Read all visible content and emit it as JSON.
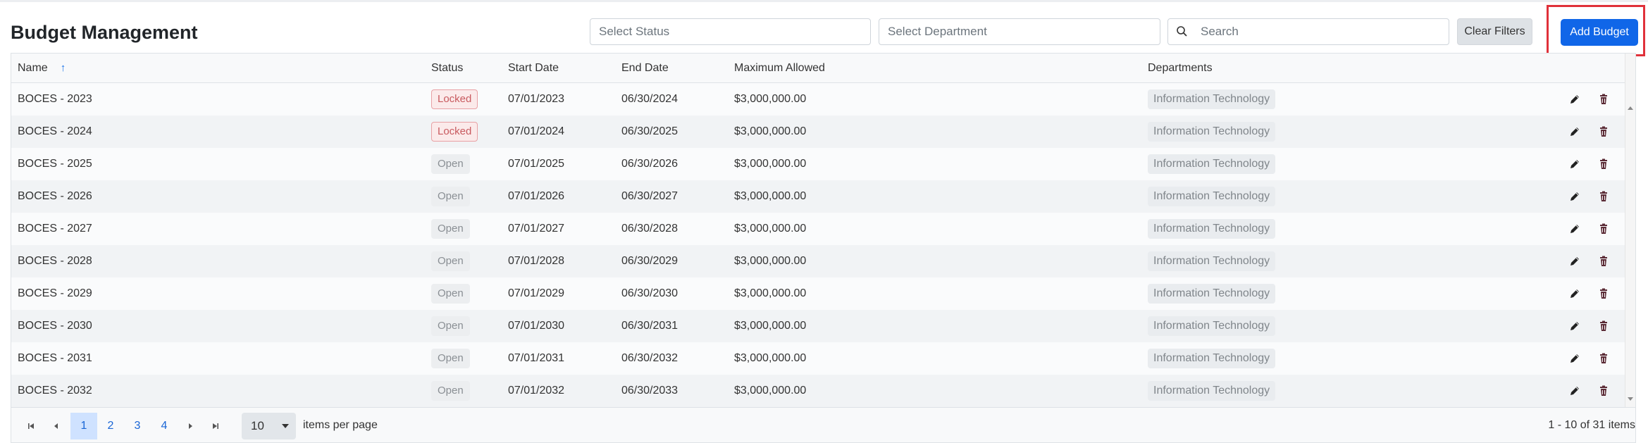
{
  "header": {
    "title": "Budget Management",
    "status_placeholder": "Select Status",
    "department_placeholder": "Select Department",
    "search_placeholder": "Search",
    "clear_filters_label": "Clear Filters",
    "add_budget_label": "Add Budget",
    "highlight_color": "#e0313a"
  },
  "table": {
    "columns": {
      "name": "Name",
      "status": "Status",
      "start_date": "Start Date",
      "end_date": "End Date",
      "maximum_allowed": "Maximum Allowed",
      "departments": "Departments"
    },
    "sort": {
      "column": "Name",
      "direction": "ascending"
    },
    "rows": [
      {
        "name": "BOCES - 2023",
        "status": "Locked",
        "start": "07/01/2023",
        "end": "06/30/2024",
        "max": "$3,000,000.00",
        "dept": "Information Technology"
      },
      {
        "name": "BOCES - 2024",
        "status": "Locked",
        "start": "07/01/2024",
        "end": "06/30/2025",
        "max": "$3,000,000.00",
        "dept": "Information Technology"
      },
      {
        "name": "BOCES - 2025",
        "status": "Open",
        "start": "07/01/2025",
        "end": "06/30/2026",
        "max": "$3,000,000.00",
        "dept": "Information Technology"
      },
      {
        "name": "BOCES - 2026",
        "status": "Open",
        "start": "07/01/2026",
        "end": "06/30/2027",
        "max": "$3,000,000.00",
        "dept": "Information Technology"
      },
      {
        "name": "BOCES - 2027",
        "status": "Open",
        "start": "07/01/2027",
        "end": "06/30/2028",
        "max": "$3,000,000.00",
        "dept": "Information Technology"
      },
      {
        "name": "BOCES - 2028",
        "status": "Open",
        "start": "07/01/2028",
        "end": "06/30/2029",
        "max": "$3,000,000.00",
        "dept": "Information Technology"
      },
      {
        "name": "BOCES - 2029",
        "status": "Open",
        "start": "07/01/2029",
        "end": "06/30/2030",
        "max": "$3,000,000.00",
        "dept": "Information Technology"
      },
      {
        "name": "BOCES - 2030",
        "status": "Open",
        "start": "07/01/2030",
        "end": "06/30/2031",
        "max": "$3,000,000.00",
        "dept": "Information Technology"
      },
      {
        "name": "BOCES - 2031",
        "status": "Open",
        "start": "07/01/2031",
        "end": "06/30/2032",
        "max": "$3,000,000.00",
        "dept": "Information Technology"
      },
      {
        "name": "BOCES - 2032",
        "status": "Open",
        "start": "07/01/2032",
        "end": "06/30/2033",
        "max": "$3,000,000.00",
        "dept": "Information Technology"
      }
    ],
    "row_actions": [
      "edit-icon",
      "trash-icon"
    ]
  },
  "pager": {
    "pages": [
      "1",
      "2",
      "3",
      "4"
    ],
    "current_page": "1",
    "page_size": "10",
    "items_per_page_label": "items per page",
    "summary": "1 - 10 of 31 items"
  }
}
